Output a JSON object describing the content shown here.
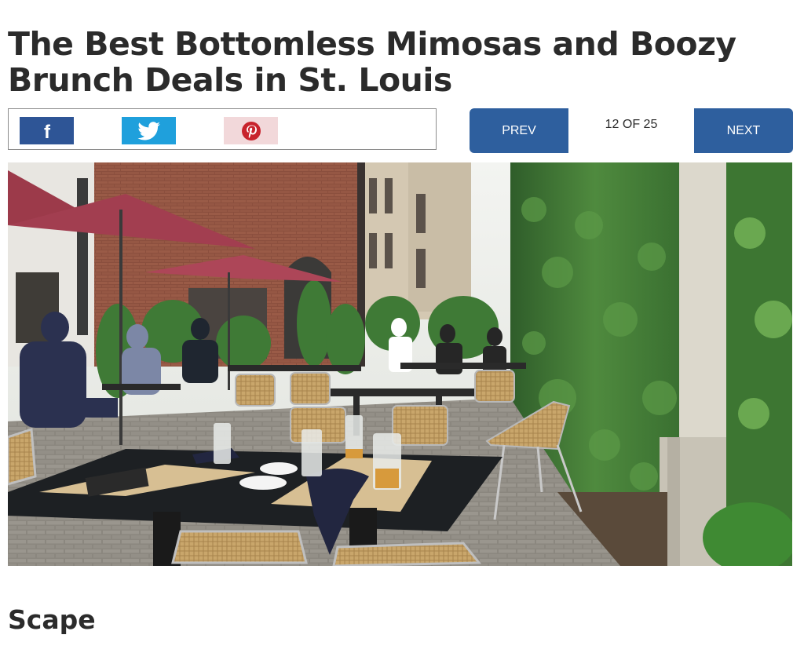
{
  "article": {
    "title": "The Best Bottomless Mimosas and Boozy Brunch Deals in St. Louis"
  },
  "share": {
    "facebook": {
      "icon": "facebook-icon",
      "glyph": "f",
      "color": "#2e5596"
    },
    "twitter": {
      "icon": "twitter-icon",
      "color": "#1fa0dc"
    },
    "pinterest": {
      "icon": "pinterest-icon",
      "color": "#f2d8da",
      "accent": "#c8232c"
    }
  },
  "gallery": {
    "prev_label": "PREV",
    "next_label": "NEXT",
    "counter": "12 OF 25",
    "button_color": "#2e5f9e"
  },
  "section": {
    "heading": "Scape"
  }
}
